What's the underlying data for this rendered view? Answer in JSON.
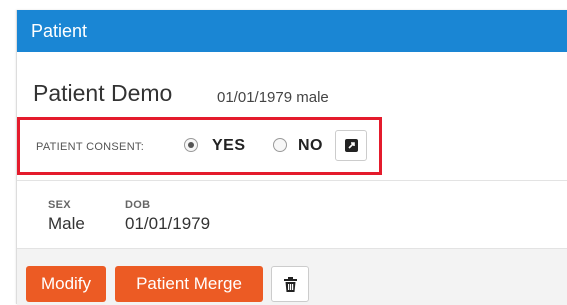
{
  "panel": {
    "title": "Patient",
    "header_color": "#1a86d4"
  },
  "patient": {
    "name": "Patient Demo",
    "meta": "01/01/1979 male"
  },
  "consent": {
    "label": "PATIENT CONSENT:",
    "options": [
      {
        "label": "YES",
        "selected": true
      },
      {
        "label": "NO",
        "selected": false
      }
    ],
    "open_icon": "external-link-icon",
    "highlight_color": "#e41b2c"
  },
  "details": {
    "sex_label": "SEX",
    "sex_value": "Male",
    "dob_label": "DOB",
    "dob_value": "01/01/1979"
  },
  "actions": {
    "modify_label": "Modify",
    "merge_label": "Patient Merge",
    "delete_icon": "trash-icon",
    "button_color": "#ec5b24"
  }
}
